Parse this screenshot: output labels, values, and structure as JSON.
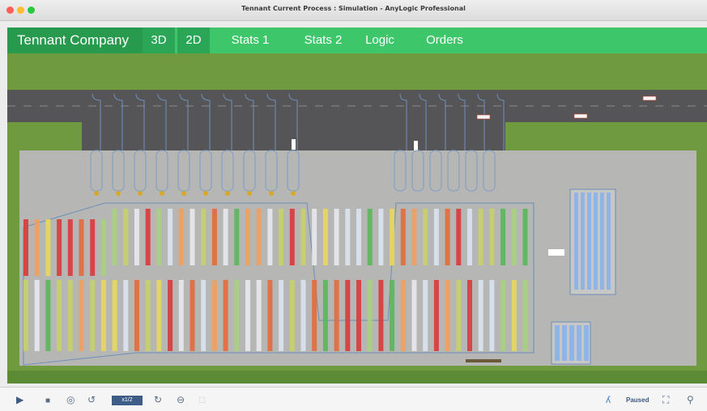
{
  "window": {
    "title": "Tennant Current Process : Simulation - AnyLogic Professional",
    "traffic_lights": [
      "#ff5f57",
      "#febc2e",
      "#28c840"
    ]
  },
  "nav": {
    "brand": "Tennant Company",
    "items": [
      {
        "label": "3D",
        "active": true
      },
      {
        "label": "2D",
        "active": true
      },
      {
        "label": "Stats 1",
        "active": false
      },
      {
        "label": "Stats 2",
        "active": false
      },
      {
        "label": "Logic",
        "active": false
      },
      {
        "label": "Orders",
        "active": false
      }
    ],
    "colors": {
      "bar": "#3dc76a",
      "brand_bg": "#279a4e",
      "active_bg": "#2aa656"
    }
  },
  "canvas": {
    "colors": {
      "grass": "#6f9a3f",
      "road": "#555558",
      "floor": "#b6b6b4",
      "lane": "#6f8fb8",
      "yard": "#c7c7c5"
    },
    "rack_palette": [
      "#d9e3ef",
      "#e8d85a",
      "#e46a3c",
      "#d93a3a",
      "#5ab65a",
      "#f0a060",
      "#c8d06a",
      "#a8d080",
      "#e8e8f0"
    ]
  },
  "controls": {
    "play_icon": "play-icon",
    "stop_icon": "stop-icon",
    "speed_label": "x1/2",
    "status": "Paused"
  }
}
